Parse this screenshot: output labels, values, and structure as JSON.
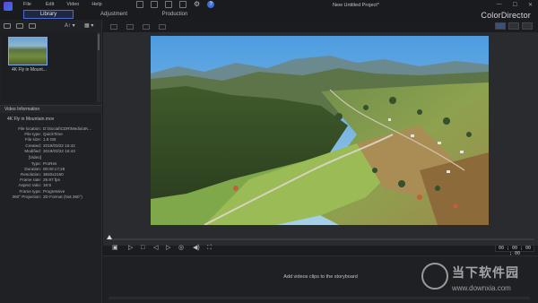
{
  "menu": {
    "items": [
      "File",
      "Edit",
      "Video",
      "Help"
    ]
  },
  "window": {
    "project_title": "New Untitled Project*",
    "brand": "ColorDirector",
    "controls": [
      "—",
      "☐",
      "✕"
    ]
  },
  "tabs": [
    {
      "label": "Library",
      "active": true
    },
    {
      "label": "Adjustment",
      "active": false
    },
    {
      "label": "Production",
      "active": false
    }
  ],
  "library": {
    "sort_label": "A↑ ▾",
    "view_label": "▦ ▾",
    "clip_label": "4K Fly in Mount..."
  },
  "video_info": {
    "header": "Video Information",
    "file_name": "4K Fly in Mountain.mov",
    "rows": [
      {
        "k": "File location:",
        "v": "D:\\Social\\CDR\\Media\\4K..."
      },
      {
        "k": "File type:",
        "v": "QuickTime"
      },
      {
        "k": "File size:",
        "v": "1.8 GB"
      },
      {
        "k": "Created:",
        "v": "2019/03/22 15:42"
      },
      {
        "k": "Modified:",
        "v": "2019/03/22 16:43"
      },
      {
        "k": "[Video]",
        "v": "",
        "gap": true
      },
      {
        "k": "Type:",
        "v": "ProRes"
      },
      {
        "k": "Duration:",
        "v": "00:00:17;28"
      },
      {
        "k": "Resolution:",
        "v": "3840x2160"
      },
      {
        "k": "Frame rate:",
        "v": "29.97 fps"
      },
      {
        "k": "Aspect ratio:",
        "v": "16:9"
      },
      {
        "k": "Frame type:",
        "v": "Progressive"
      },
      {
        "k": "360° Projection:",
        "v": "2D Format (Not 360°)"
      }
    ]
  },
  "player": {
    "timecode": "00 ; 00 ; 00 ; 00"
  },
  "storyboard": {
    "message": "Add videos clips to the storyboard"
  },
  "watermark": {
    "text": "当下软件园",
    "url": "www.downxia.com"
  },
  "colors": {
    "accent": "#4b6cd0",
    "panel": "#202124",
    "background": "#1b1c1f"
  }
}
